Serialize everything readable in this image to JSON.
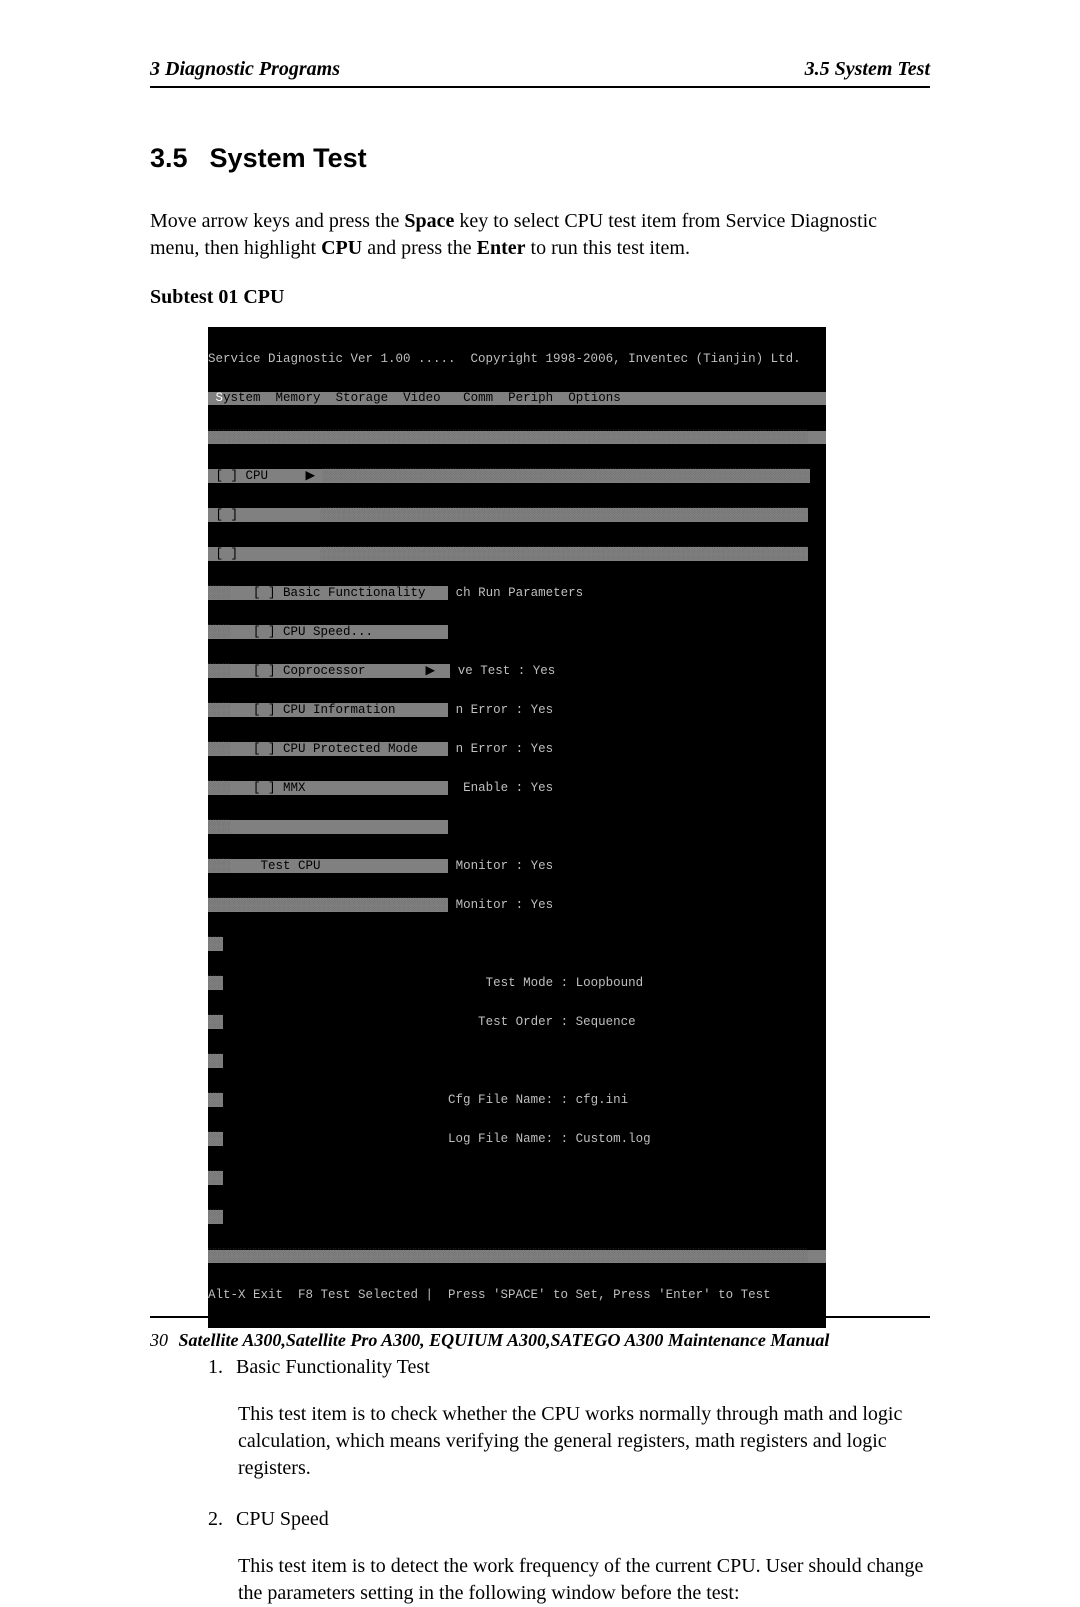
{
  "header": {
    "left": "3  Diagnostic Programs",
    "right": "3.5 System Test"
  },
  "section": {
    "number": "3.5",
    "title": "System Test"
  },
  "intro": {
    "line_pre": "Move arrow keys and press the ",
    "space": "Space",
    "line_mid1": " key to select CPU test item from Service Diagnostic menu, then highlight ",
    "cpu": "CPU",
    "line_mid2": " and press the ",
    "enter": "Enter",
    "line_post": " to run this test item."
  },
  "subtest": "Subtest 01 CPU",
  "dos": {
    "title": "Service Diagnostic Ver 1.00 .....  Copyright 1998-2006, Inventec (Tianjin) Ltd.",
    "menubar": " System  Memory  Storage  Video   Comm  Periph  Options",
    "shade_row": "░░░░░░░░░░░░░░░░░░░░░░░░░░░░░░░░░░░░░░░░░░░░░░░░░░░░░░░░░░░░░░░░░░░░░░░░░░░░░░░░",
    "left_cpu_row": " [ ] CPU     ▶ ",
    "left_blank1": " [ ]           ",
    "left_blank2": " [ ]           ",
    "submenu": {
      "basic": " [ ] Basic Functionality   ",
      "speed": " [ ] CPU Speed...          ",
      "copro": " [ ] Coprocessor        ▶  ",
      "info": " [ ] CPU Information       ",
      "prot": " [ ] CPU Protected Mode    ",
      "mmx": " [ ] MMX                   ",
      "blank": "                           ",
      "testcpu": "  Test CPU                 "
    },
    "right_header": "ch Run Parameters",
    "params": {
      "r1": "ve Test : Yes",
      "r2": "n Error : Yes",
      "r3": "n Error : Yes",
      "r4": " Enable : Yes",
      "r5": "Monitor : Yes",
      "r6": "Monitor : Yes"
    },
    "mid": {
      "m1": "             Test Mode : Loopbound",
      "m2": "            Test Order : Sequence",
      "m3": "        Cfg File Name: : cfg.ini",
      "m4": "        Log File Name: : Custom.log"
    },
    "status": "Alt-X Exit  F8 Test Selected |  Press 'SPACE' to Set, Press 'Enter' to Test"
  },
  "items": [
    {
      "num": "1.",
      "title": "Basic Functionality Test",
      "body": "This test item is to check whether the CPU works normally through math and logic calculation, which means verifying the general registers, math registers and logic registers."
    },
    {
      "num": "2.",
      "title": "CPU Speed",
      "body": "This test item is to detect the work frequency of the current CPU. User should change the parameters setting in the following window before the test:"
    }
  ],
  "footer": {
    "page": "30",
    "title": "Satellite A300,Satellite Pro A300, EQUIUM A300,SATEGO A300 Maintenance Manual"
  }
}
